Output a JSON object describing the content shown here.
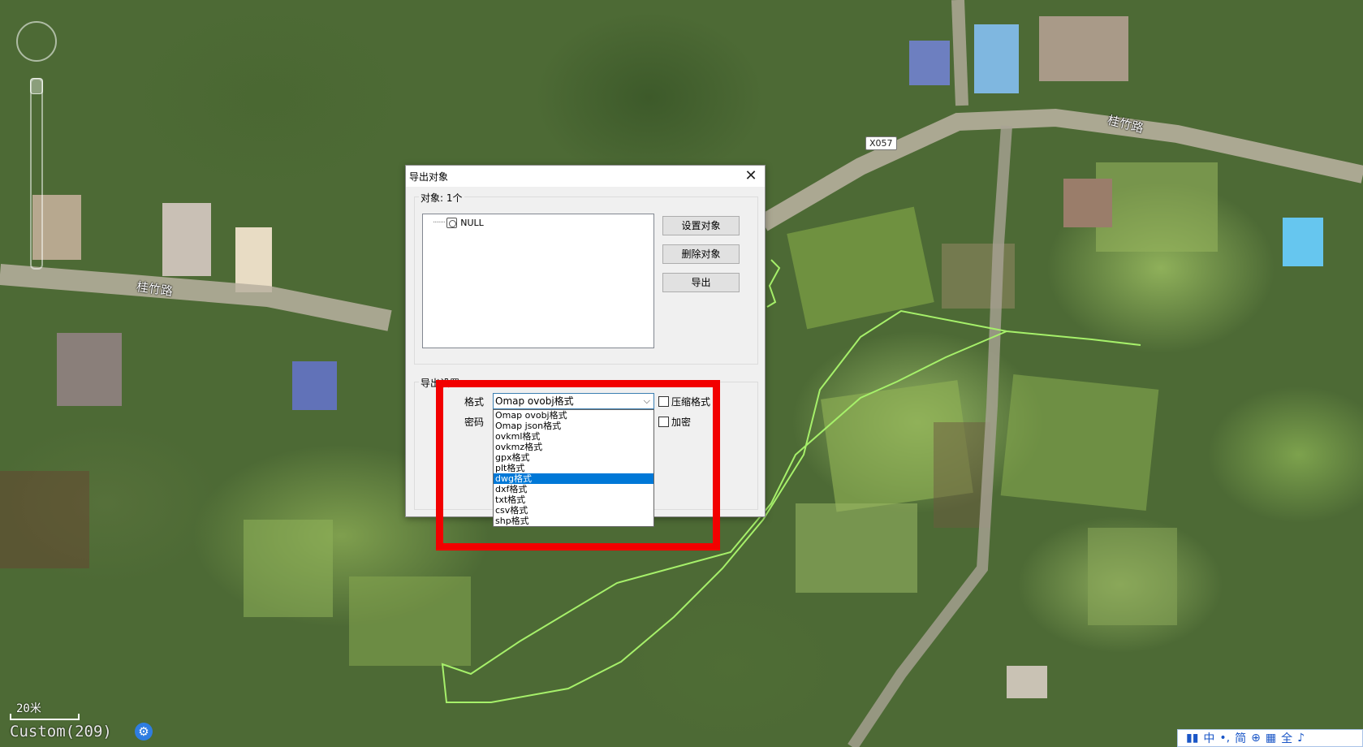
{
  "map": {
    "road_name": "桂竹路",
    "road_name_2": "桂竹路",
    "road_badge": "X057",
    "scale_label": "20米",
    "layer_label": "Custom(209)",
    "settings_icon": "gear-icon",
    "colors": {
      "track_line": "#a6f06a",
      "highlight": "#f20000"
    }
  },
  "ime": {
    "items": [
      "中",
      "•,",
      "简",
      "⊕",
      "▦",
      "全",
      "♪"
    ]
  },
  "dialog": {
    "title": "导出对象",
    "close_icon": "close-icon",
    "objects_group_label": "对象: 1个",
    "tree_node_label": "NULL",
    "buttons": {
      "set_objects": "设置对象",
      "delete_objects": "删除对象",
      "export": "导出"
    },
    "options_group_label": "导出设置",
    "format_label": "格式",
    "password_label": "密码",
    "format_selected": "Omap ovobj格式",
    "compress_label": "压缩格式",
    "encrypt_label": "加密",
    "format_options": [
      "Omap ovobj格式",
      "Omap json格式",
      "ovkml格式",
      "ovkmz格式",
      "gpx格式",
      "plt格式",
      "dwg格式",
      "dxf格式",
      "txt格式",
      "csv格式",
      "shp格式"
    ],
    "highlighted_option": "dwg格式"
  }
}
